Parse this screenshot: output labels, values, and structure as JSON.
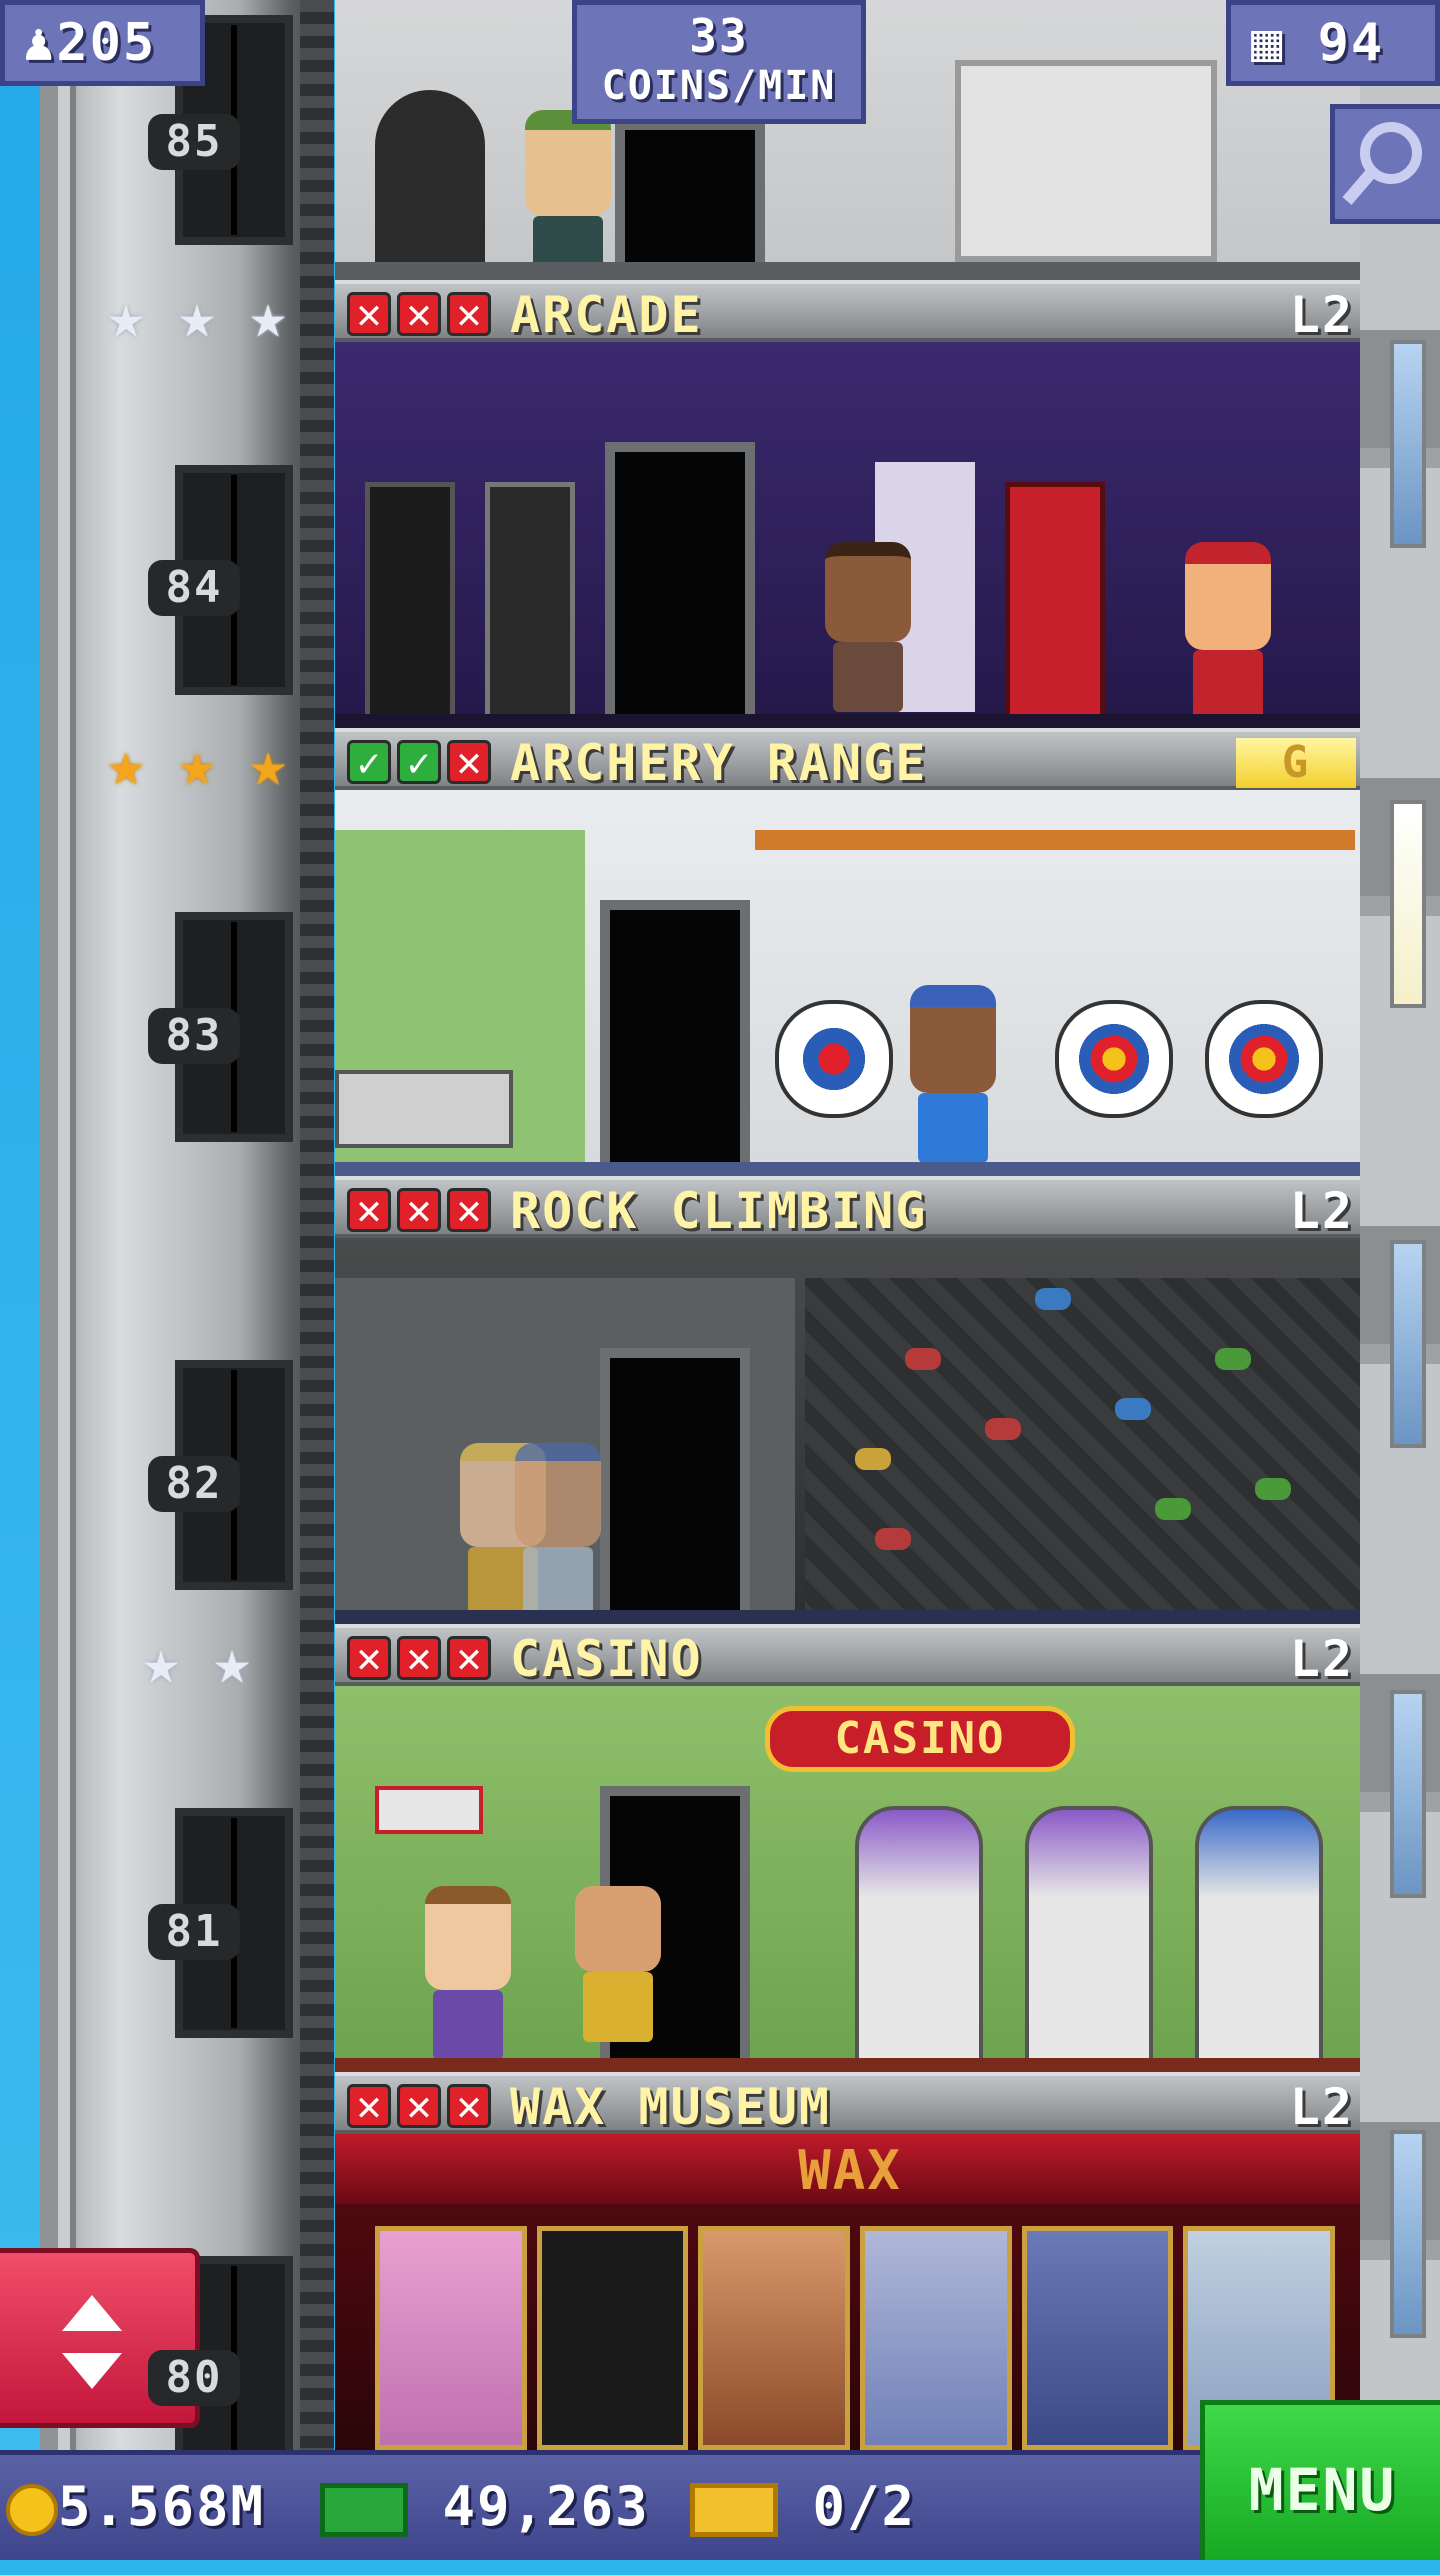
{
  "hud": {
    "population": "205",
    "coins_rate_value": "33",
    "coins_rate_unit": "COINS/MIN",
    "floors_count": "94"
  },
  "floor_numbers": [
    "85",
    "84",
    "83",
    "82",
    "81",
    "80"
  ],
  "floors": [
    {
      "name": "ARCADE",
      "level": "L2",
      "marks": [
        "x",
        "x",
        "x"
      ],
      "stars": 3,
      "star_color": "silver"
    },
    {
      "name": "ARCHERY RANGE",
      "level": "G",
      "marks": [
        "ok",
        "ok",
        "x"
      ],
      "stars": 3,
      "star_color": "gold"
    },
    {
      "name": "ROCK CLIMBING",
      "level": "L2",
      "marks": [
        "x",
        "x",
        "x"
      ],
      "stars": 0,
      "star_color": "none"
    },
    {
      "name": "CASINO",
      "level": "L2",
      "marks": [
        "x",
        "x",
        "x"
      ],
      "stars": 2,
      "star_color": "silver"
    },
    {
      "name": "WAX MUSEUM",
      "level": "L2",
      "marks": [
        "x",
        "x",
        "x"
      ],
      "stars": 0,
      "star_color": "none"
    }
  ],
  "signs": {
    "casino": "CASINO",
    "wax": "WAX"
  },
  "bottom_bar": {
    "coins": "5.568M",
    "bux": "49,263",
    "tickets": "0/2",
    "menu_label": "MENU"
  },
  "colors": {
    "hud": "#6d74b8",
    "menu": "#22c22f",
    "elevator_button": "#e0304f",
    "room_name": "#fff3a6"
  },
  "icons": {
    "population": "person-icon",
    "floors": "building-icon",
    "search": "magnifier-icon",
    "coins": "coin-icon",
    "bux": "bux-icon",
    "tickets": "ticket-icon",
    "elevator": "up-down-arrows-icon"
  }
}
